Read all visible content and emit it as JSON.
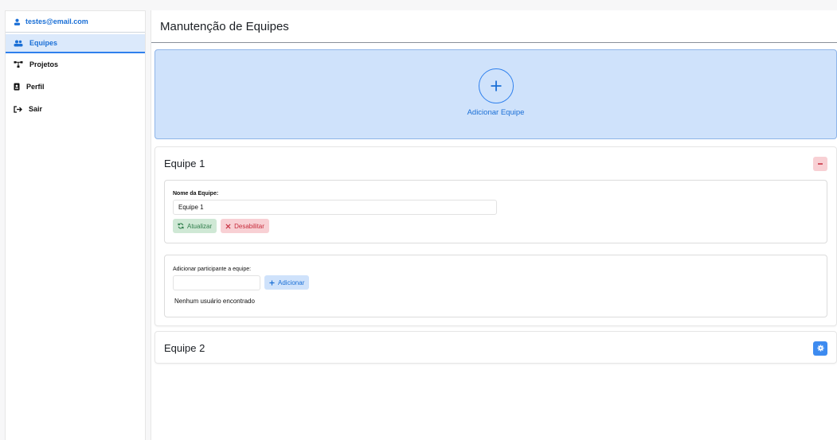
{
  "sidebar": {
    "user_email": "testes@email.com",
    "items": [
      {
        "label": "Equipes",
        "icon": "users-icon",
        "active": true
      },
      {
        "label": "Projetos",
        "icon": "project-diagram-icon",
        "active": false
      },
      {
        "label": "Perfil",
        "icon": "id-badge-icon",
        "active": false
      },
      {
        "label": "Sair",
        "icon": "sign-out-icon",
        "active": false
      }
    ]
  },
  "main": {
    "title": "Manutenção de Equipes",
    "add_team_label": "Adicionar Equipe",
    "teams": [
      {
        "name": "Equipe 1",
        "expanded": true,
        "field_label": "Nome da Equipe:",
        "field_value": "Equipe 1",
        "update_label": "Atualizar",
        "disable_label": "Desabilitar",
        "participant_label": "Adicionar participante a equipe:",
        "participant_value": "",
        "add_label": "Adicionar",
        "empty_message": "Nenhum usuário encontrado"
      },
      {
        "name": "Equipe 2",
        "expanded": false
      }
    ]
  },
  "colors": {
    "accent": "#2f80ed",
    "success": "#2e7d4a",
    "danger": "#c62b3b"
  }
}
